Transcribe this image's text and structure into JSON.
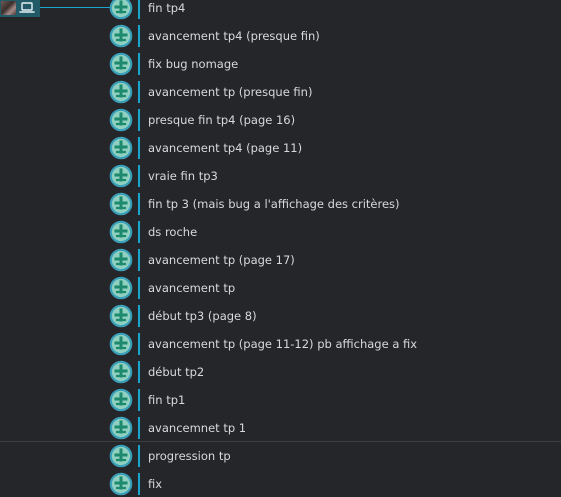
{
  "branch": {
    "icon": "laptop-icon",
    "avatar": "user-avatar",
    "color": "#235a67",
    "line_color": "#1aa6cc"
  },
  "node": {
    "icon": "commit-node-icon",
    "ring_color": "#3a9fb8",
    "fill_color": "#2ea37a"
  },
  "commits": [
    {
      "message": "fin tp4"
    },
    {
      "message": "avancement tp4 (presque fin)"
    },
    {
      "message": "fix bug nomage"
    },
    {
      "message": "avancement tp (presque fin)"
    },
    {
      "message": "presque fin tp4 (page 16)"
    },
    {
      "message": "avancement tp4 (page 11)"
    },
    {
      "message": "vraie fin tp3"
    },
    {
      "message": "fin tp 3 (mais bug a l'affichage des critères)"
    },
    {
      "message": "ds roche"
    },
    {
      "message": "avancement tp (page 17)"
    },
    {
      "message": "avancement tp"
    },
    {
      "message": "début tp3 (page 8)"
    },
    {
      "message": "avancement tp (page 11-12) pb affichage a fix"
    },
    {
      "message": "début tp2"
    },
    {
      "message": "fin tp1"
    },
    {
      "message": "avancemnet tp 1"
    },
    {
      "message": "progression tp"
    },
    {
      "message": "fix"
    }
  ]
}
